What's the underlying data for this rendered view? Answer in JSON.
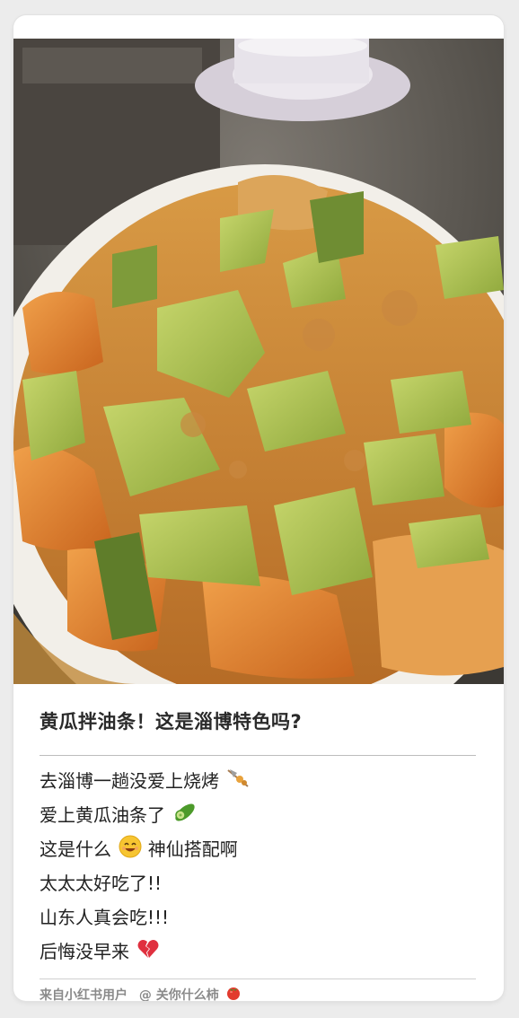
{
  "post": {
    "title": "黄瓜拌油条！这是淄博特色吗?",
    "lines": [
      {
        "text": "去淄博一趟没爱上烧烤",
        "emoji": "skewer-icon"
      },
      {
        "text": "爱上黄瓜油条了",
        "emoji": "cucumber-icon"
      },
      {
        "text": "这是什么",
        "emoji": "smiling-face-icon",
        "after": "神仙搭配啊"
      },
      {
        "text": "太太太好吃了!!",
        "emoji": ""
      },
      {
        "text": "山东人真会吃!!!",
        "emoji": ""
      },
      {
        "text": "后悔没早来",
        "emoji": "broken-heart-icon"
      }
    ]
  },
  "footer": {
    "source": "来自小红书用户",
    "user": "@ 关你什么柿",
    "user_emoji": "tomato-icon"
  },
  "photo": {
    "subject": "cucumber-youtiao-dish-photo"
  },
  "colors": {
    "title": "#2a2a2a",
    "body": "#222222",
    "footer": "#8a8a8a"
  }
}
